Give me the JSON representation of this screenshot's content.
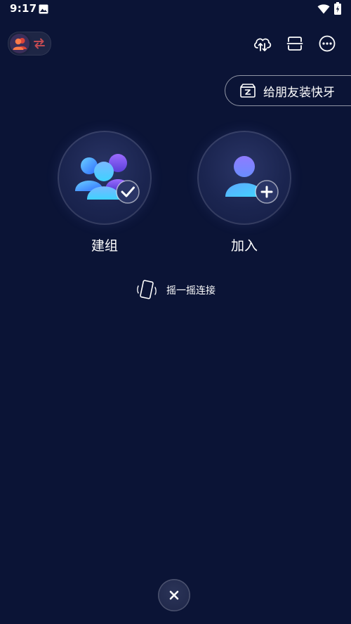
{
  "status_bar": {
    "time": "9:17",
    "icons": [
      "gallery-icon",
      "wifi-icon",
      "battery-charging-icon"
    ]
  },
  "toolbar": {
    "mode_switch_icons": [
      "group-users-icon",
      "swap-arrows-icon"
    ],
    "actions": [
      "cloud-sync-icon",
      "scan-icon",
      "more-icon"
    ]
  },
  "quick_install": {
    "label": "给朋友装快牙",
    "icon": "zapya-box-icon"
  },
  "main": {
    "create_group": {
      "label": "建组",
      "icon": "group-check-icon"
    },
    "join_group": {
      "label": "加入",
      "icon": "user-plus-icon"
    },
    "shake": {
      "label": "摇一摇连接",
      "icon": "shake-phone-icon"
    }
  },
  "close": {
    "icon": "close-icon"
  },
  "colors": {
    "background": "#0b1436",
    "orb": "#1b2550",
    "accent_blue": "#3fa0ff",
    "accent_purple": "#8a5cff",
    "switch_knob_orange": "#ff6a3d"
  }
}
